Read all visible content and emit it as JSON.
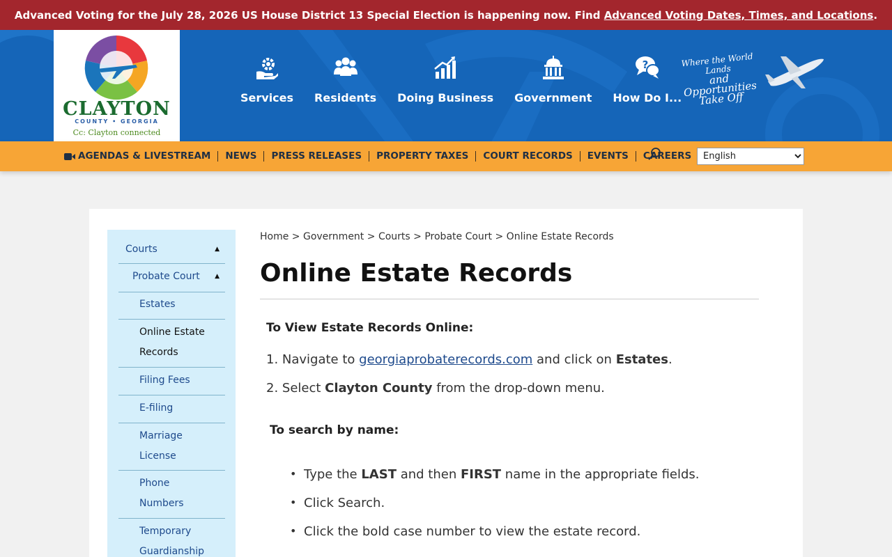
{
  "alert": {
    "text": "Advanced Voting for the July 28, 2026 US House District 13 Special Election is happening now. Find ",
    "link": "Advanced Voting Dates, Times, and Locations",
    "end": "."
  },
  "logo": {
    "word": "CLAYTON",
    "sub": "COUNTY • GEORGIA",
    "tag": "Cc: Clayton connected"
  },
  "main_nav": [
    {
      "label": "Services",
      "icon": "gear-hand-icon"
    },
    {
      "label": "Residents",
      "icon": "people-icon"
    },
    {
      "label": "Doing Business",
      "icon": "chart-icon"
    },
    {
      "label": "Government",
      "icon": "capitol-icon"
    },
    {
      "label": "How Do I...",
      "icon": "question-bubble-icon"
    }
  ],
  "tagline": {
    "line1": "Where the World Lands",
    "line2": "and Opportunities",
    "line3": "Take Off"
  },
  "util_nav": [
    "AGENDAS & LIVESTREAM",
    "NEWS",
    "PRESS RELEASES",
    "PROPERTY TAXES",
    "COURT RECORDS",
    "EVENTS",
    "CAREERS"
  ],
  "language": {
    "selected": "English"
  },
  "sidebar": {
    "items": [
      "Courts",
      "Probate Court",
      "Estates",
      "Online Estate Records",
      "Filing Fees",
      "E-filing",
      "Marriage License",
      "Phone Numbers",
      "Temporary Guardianship"
    ]
  },
  "breadcrumb": {
    "home": "Home",
    "government": "Government",
    "courts": "Courts",
    "probate": "Probate Court",
    "current": "Online Estate Records",
    "sep": ">"
  },
  "page": {
    "title": "Online Estate Records",
    "view_head": "To View Estate Records Online:",
    "step1_pre": "1. Navigate to ",
    "step1_link": "georgiaprobaterecords.com",
    "step1_mid": " and click on ",
    "step1_bold": "Estates",
    "step1_end": ".",
    "step2_pre": "2. Select ",
    "step2_bold": "Clayton County",
    "step2_end": " from the drop-down menu.",
    "search_head": "To search by name:",
    "bullet1_pre": "Type the ",
    "bullet1_b1": "LAST",
    "bullet1_mid": " and then ",
    "bullet1_b2": "FIRST",
    "bullet1_end": " name in the appropriate fields.",
    "bullet2": "Click Search.",
    "bullet3": "Click the bold case number to view the estate record."
  },
  "colors": {
    "alert_bg": "#a3262d",
    "header_bg": "#1565b8",
    "util_bg": "#f7a536",
    "sidebar_bg": "#d5effb",
    "link": "#1e4a8c"
  }
}
